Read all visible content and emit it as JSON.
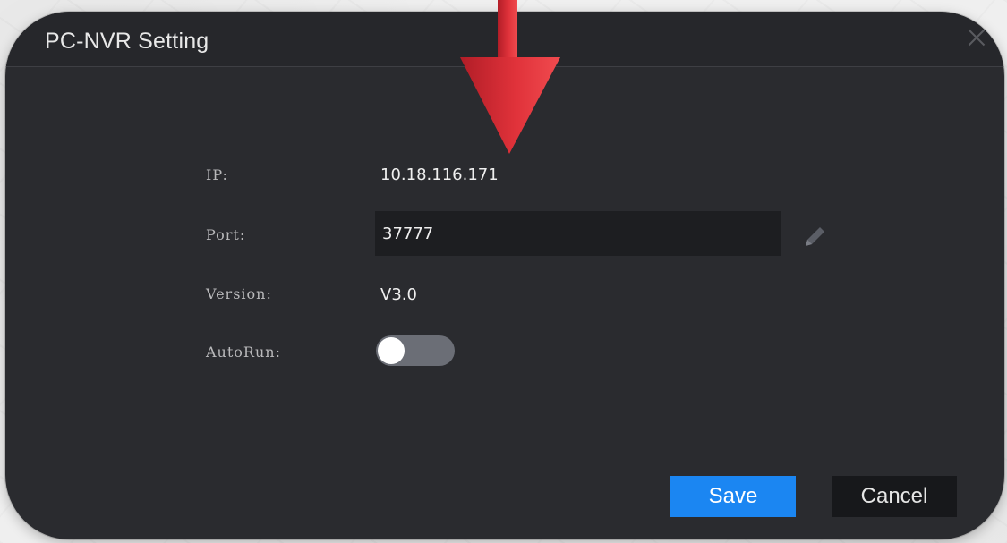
{
  "dialog": {
    "title": "PC-NVR Setting",
    "close_icon": "close-icon"
  },
  "fields": {
    "ip_label": "IP:",
    "ip_value": "10.18.116.171",
    "port_label": "Port:",
    "port_value": "37777",
    "version_label": "Version:",
    "version_value": "V3.0",
    "autorun_label": "AutoRun:",
    "autorun_enabled": false
  },
  "icons": {
    "edit": "pencil-edit-icon",
    "annotation": "red-arrow-down-icon"
  },
  "buttons": {
    "save_label": "Save",
    "cancel_label": "Cancel"
  },
  "colors": {
    "dialog_bg": "#2a2b2f",
    "save_button": "#1b86f2",
    "cancel_button": "#17181b",
    "toggle_off": "#6b6e76",
    "annotation_arrow": "#e0323a"
  }
}
